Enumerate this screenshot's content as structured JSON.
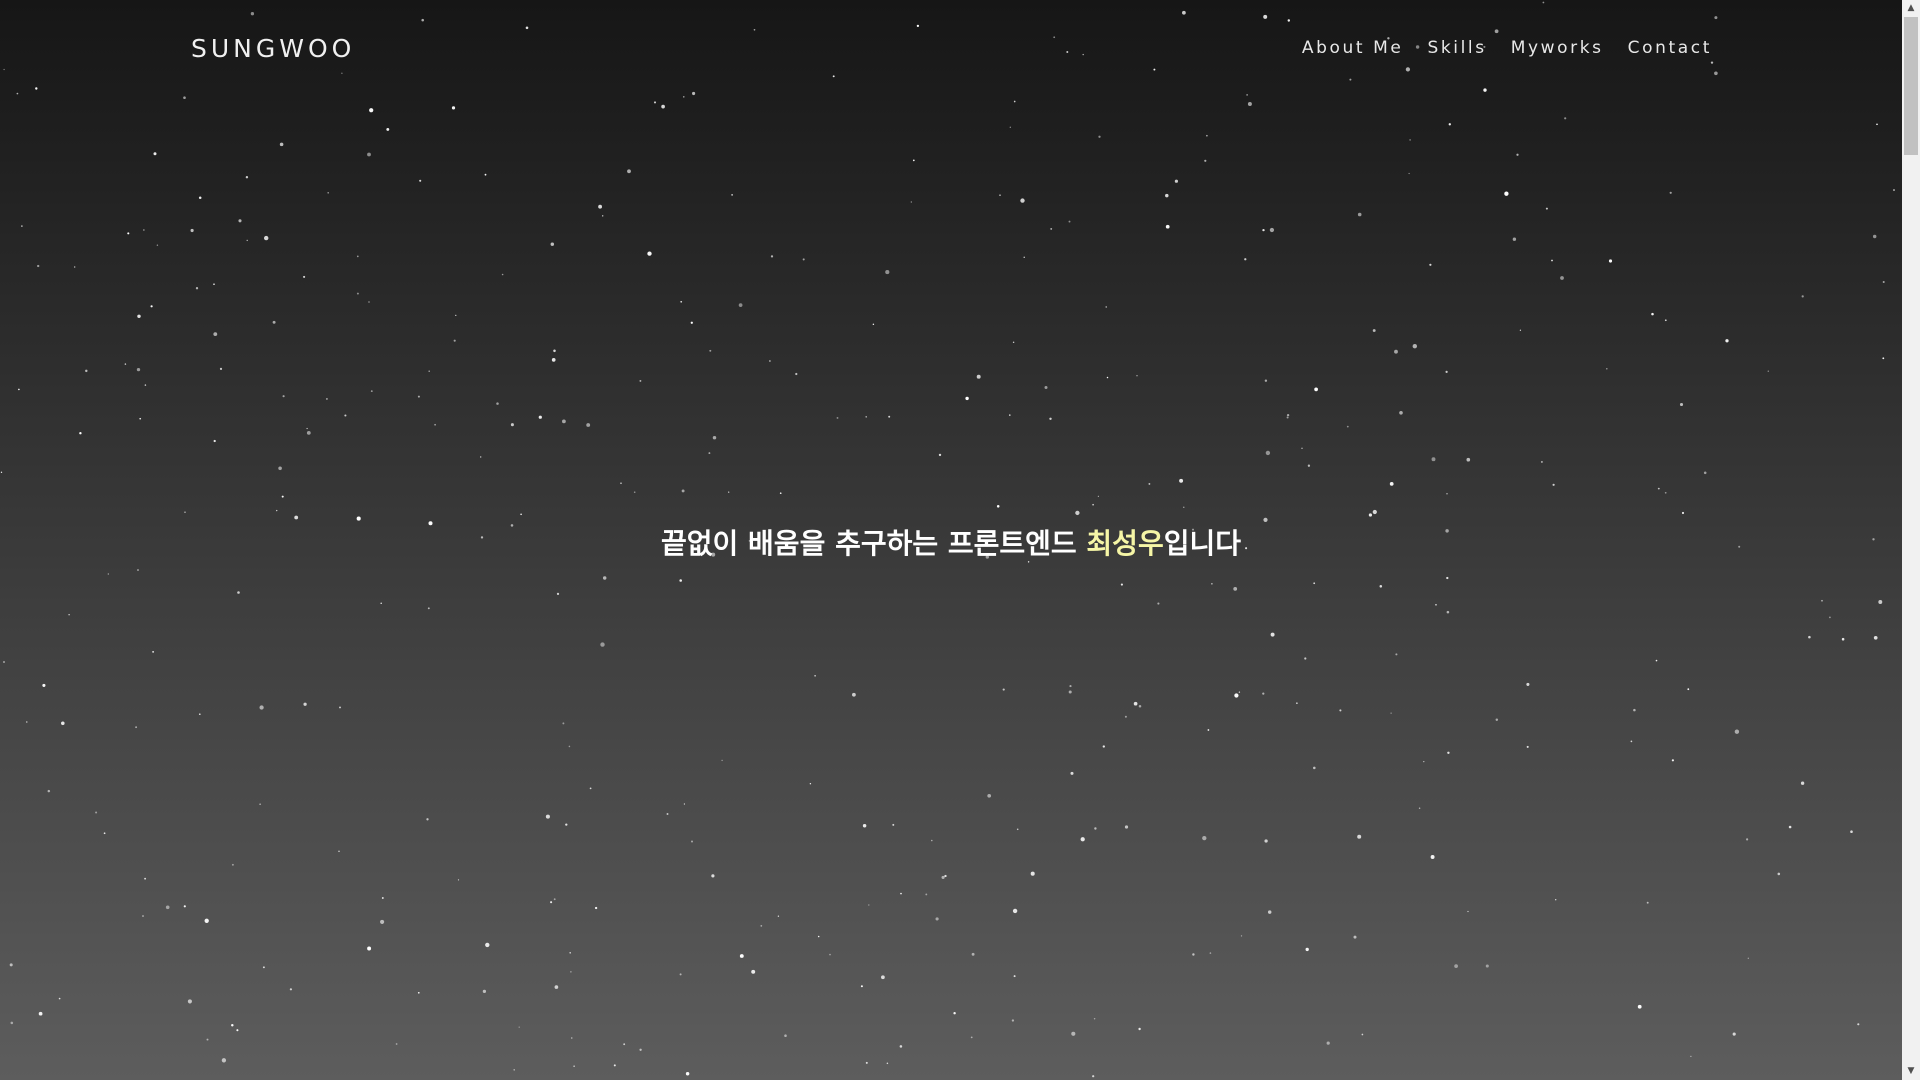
{
  "page": {
    "background_top": "#161616",
    "background_bottom": "#5d5d5d",
    "star_color": "#ffffff"
  },
  "navbar": {
    "logo": "SUNGWOO",
    "items": [
      {
        "label": "About Me"
      },
      {
        "label": "Skills"
      },
      {
        "label": "Myworks"
      },
      {
        "label": "Contact"
      }
    ]
  },
  "hero": {
    "prefix": "끝없이 배움을 추구하는 프론트엔드 ",
    "name": "최성우",
    "suffix": "입니다",
    "highlight_color": "#f6f6a6"
  },
  "scrollbar": {
    "up_icon": "arrow-up-icon",
    "down_icon": "arrow-down-icon"
  }
}
